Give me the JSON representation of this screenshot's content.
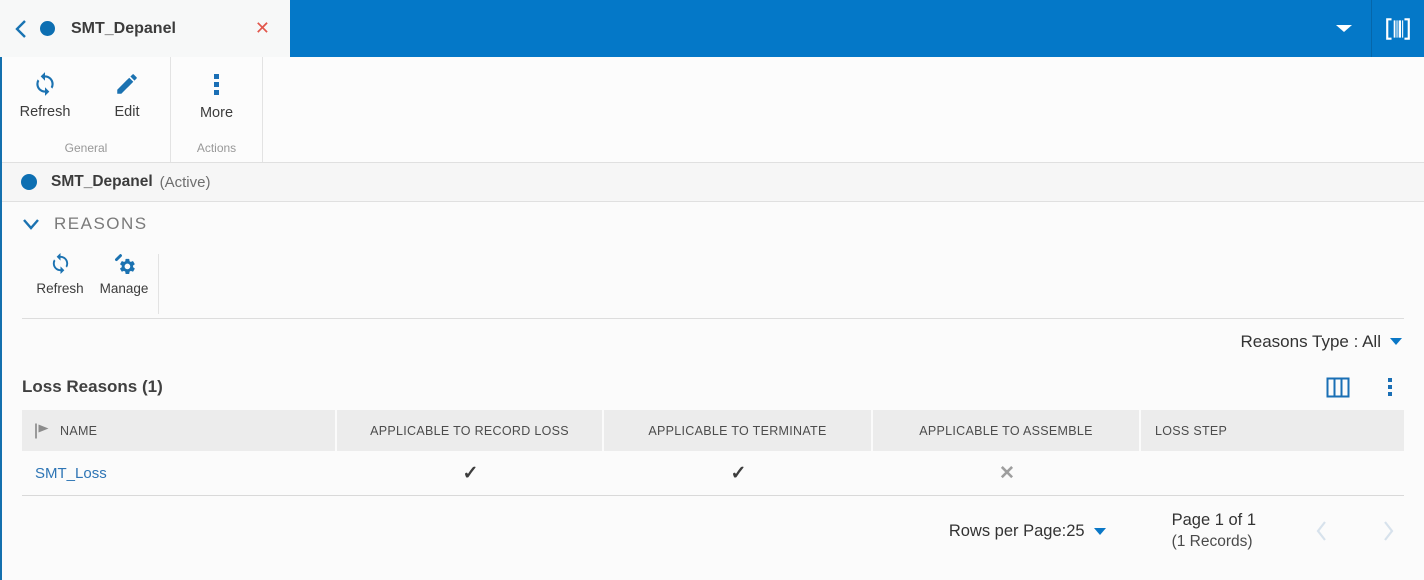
{
  "topbar": {
    "tab_title": "SMT_Depanel",
    "close_glyph": "✕"
  },
  "ribbon": {
    "refresh_label": "Refresh",
    "edit_label": "Edit",
    "more_label": "More",
    "general_group_label": "General",
    "actions_group_label": "Actions"
  },
  "entity": {
    "name": "SMT_Depanel",
    "status": "(Active)"
  },
  "reasons_section": {
    "title": "REASONS",
    "refresh_label": "Refresh",
    "manage_label": "Manage",
    "filter_label": "Reasons Type : All"
  },
  "loss_reasons": {
    "title": "Loss Reasons (1)",
    "columns": [
      "NAME",
      "APPLICABLE TO RECORD LOSS",
      "APPLICABLE TO TERMINATE",
      "APPLICABLE TO ASSEMBLE",
      "LOSS STEP"
    ],
    "rows": [
      {
        "name": "SMT_Loss",
        "applicable_to_record_loss": "✓",
        "applicable_to_terminate": "✓",
        "applicable_to_assemble": "✕",
        "loss_step": ""
      }
    ]
  },
  "pagination": {
    "rows_per_page_label": "Rows per Page:",
    "rows_per_page_value": "25",
    "page_label": "Page 1 of 1",
    "records_label": "(1 Records)"
  },
  "colors": {
    "topbar_blue": "#0478c8",
    "icon_blue": "#1b72b1",
    "link_blue": "#2e75b5",
    "close_red": "#e2574c"
  }
}
